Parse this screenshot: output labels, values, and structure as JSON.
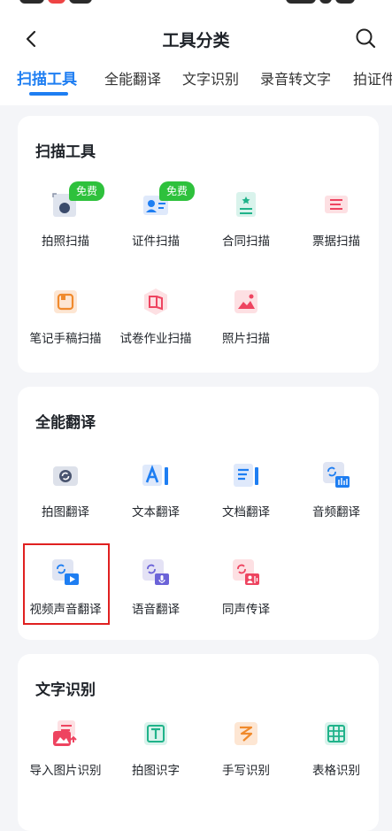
{
  "nav": {
    "title": "工具分类"
  },
  "tabs": [
    "扫描工具",
    "全能翻译",
    "文字识别",
    "录音转文字",
    "拍证件"
  ],
  "sections": {
    "scan": {
      "title": "扫描工具",
      "badge": "免费",
      "items": [
        "拍照扫描",
        "证件扫描",
        "合同扫描",
        "票据扫描",
        "笔记手稿扫描",
        "试卷作业扫描",
        "照片扫描"
      ]
    },
    "translate": {
      "title": "全能翻译",
      "items": [
        "拍图翻译",
        "文本翻译",
        "文档翻译",
        "音频翻译",
        "视频声音翻译",
        "语音翻译",
        "同声传译"
      ]
    },
    "ocr": {
      "title": "文字识别",
      "items": [
        "导入图片识别",
        "拍图识字",
        "手写识别",
        "表格识别"
      ]
    }
  },
  "colors": {
    "accent": "#1e7ef2",
    "badge": "#2ec13c",
    "highlight": "#e02020"
  },
  "icons": [
    "back-arrow-icon",
    "search-icon"
  ]
}
